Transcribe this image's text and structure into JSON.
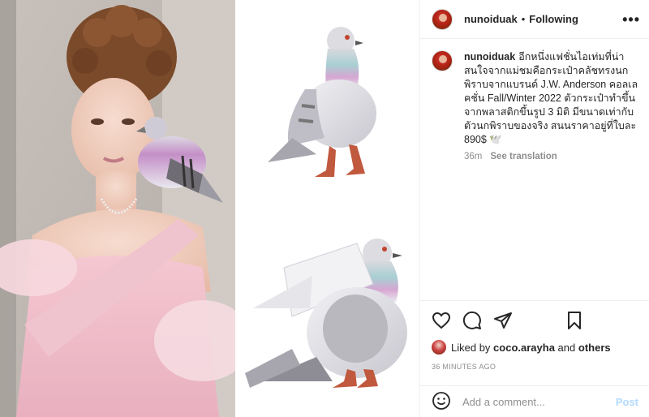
{
  "header": {
    "username": "nunoiduak",
    "separator": "•",
    "follow_status": "Following",
    "more_icon": "more-horizontal-icon"
  },
  "caption": {
    "username": "nunoiduak",
    "text": "อีกหนึ่งแฟชั่นไอเท่มที่น่าสนใจจากแม่ชมคือกระเป๋าคลัชทรงนกพิราบจากแบรนด์ J.W. Anderson คอลเลคชั่น Fall/Winter 2022 ตัวกระเป๋าทำขึ้นจากพลาสติกขึ้นรูป 3 มิติ มีขนาดเท่ากับตัวนกพิราบของจริง สนนราคาอยู่ที่ใบละ 890$ 🕊️",
    "age": "36m",
    "translate": "See translation"
  },
  "actions": {
    "like_icon": "heart-icon",
    "comment_icon": "comment-icon",
    "share_icon": "share-icon",
    "save_icon": "bookmark-icon"
  },
  "likes": {
    "prefix": "Liked by",
    "user": "coco.arayha",
    "middle": "and",
    "others": "others"
  },
  "timestamp": "36 MINUTES AGO",
  "comment_box": {
    "emoji_icon": "smiley-icon",
    "placeholder": "Add a comment...",
    "post_label": "Post"
  },
  "colors": {
    "text": "#262626",
    "muted": "#8e8e8e",
    "border": "#efefef",
    "post_disabled": "#b3dbff"
  }
}
